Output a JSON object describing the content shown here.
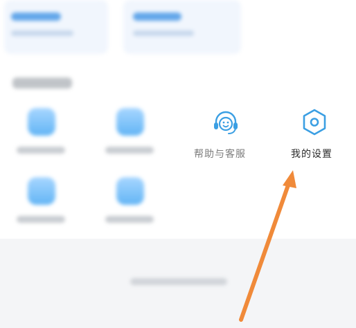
{
  "grid": {
    "help_service": {
      "label": "帮助与客服",
      "icon": "headset-smile-icon"
    },
    "my_settings": {
      "label": "我的设置",
      "icon": "hexagon-settings-icon"
    }
  },
  "colors": {
    "accent": "#3b9fe3",
    "arrow": "#f08a3a",
    "label_dark": "#2b2b2b",
    "label_gray": "#7c7c7c"
  }
}
